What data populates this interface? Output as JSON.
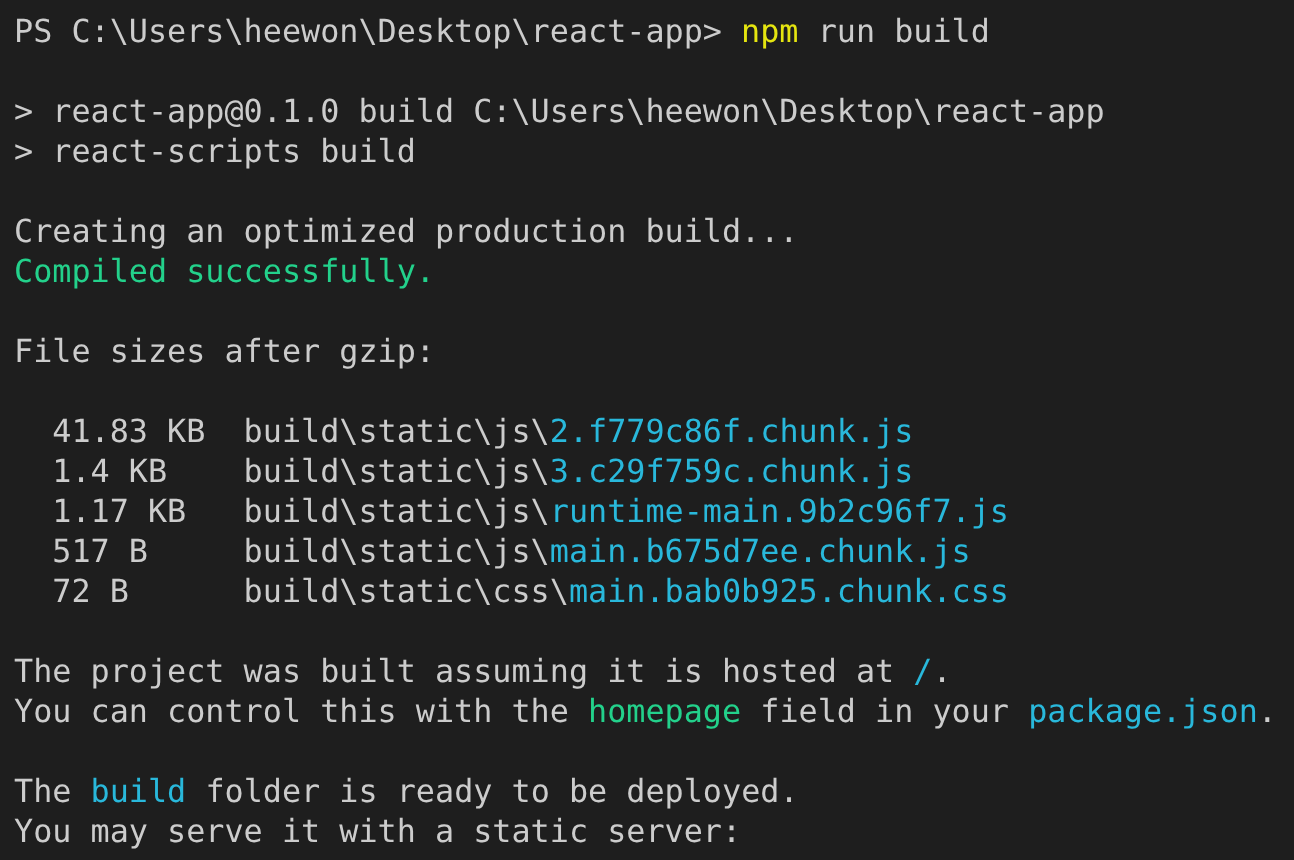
{
  "terminal": {
    "blocks": [
      {
        "lines": [
          [
            {
              "text": "PS C:\\Users\\heewon\\Desktop\\react-app> "
            },
            {
              "text": "npm",
              "color": "#e5e510"
            },
            {
              "text": " run build"
            }
          ]
        ]
      },
      {
        "lines": [
          [
            {
              "text": "> react-app@0.1.0 build C:\\Users\\heewon\\Desktop\\react-app"
            }
          ],
          [
            {
              "text": "> react-scripts build"
            }
          ]
        ]
      },
      {
        "lines": [
          [
            {
              "text": "Creating an optimized production build..."
            }
          ],
          [
            {
              "text": "Compiled successfully.",
              "color": "#23d18b"
            }
          ]
        ]
      },
      {
        "lines": [
          [
            {
              "text": "File sizes after gzip:"
            }
          ]
        ]
      },
      {
        "lines": [
          [
            {
              "text": "  41.83 KB  build\\static\\js\\"
            },
            {
              "text": "2.f779c86f.chunk.js",
              "color": "#29b8db"
            }
          ],
          [
            {
              "text": "  1.4 KB    build\\static\\js\\"
            },
            {
              "text": "3.c29f759c.chunk.js",
              "color": "#29b8db"
            }
          ],
          [
            {
              "text": "  1.17 KB   build\\static\\js\\"
            },
            {
              "text": "runtime-main.9b2c96f7.js",
              "color": "#29b8db"
            }
          ],
          [
            {
              "text": "  517 B     build\\static\\js\\"
            },
            {
              "text": "main.b675d7ee.chunk.js",
              "color": "#29b8db"
            }
          ],
          [
            {
              "text": "  72 B      build\\static\\css\\"
            },
            {
              "text": "main.bab0b925.chunk.css",
              "color": "#29b8db"
            }
          ]
        ]
      },
      {
        "lines": [
          [
            {
              "text": "The project was built assuming it is hosted at "
            },
            {
              "text": "/",
              "color": "#29b8db"
            },
            {
              "text": "."
            }
          ],
          [
            {
              "text": "You can control this with the "
            },
            {
              "text": "homepage",
              "color": "#23d18b"
            },
            {
              "text": " field in your "
            },
            {
              "text": "package.json",
              "color": "#29b8db"
            },
            {
              "text": "."
            }
          ]
        ]
      },
      {
        "lines": [
          [
            {
              "text": "The "
            },
            {
              "text": "build",
              "color": "#29b8db"
            },
            {
              "text": " folder is ready to be deployed."
            }
          ],
          [
            {
              "text": "You may serve it with a static server:"
            }
          ]
        ]
      }
    ]
  }
}
